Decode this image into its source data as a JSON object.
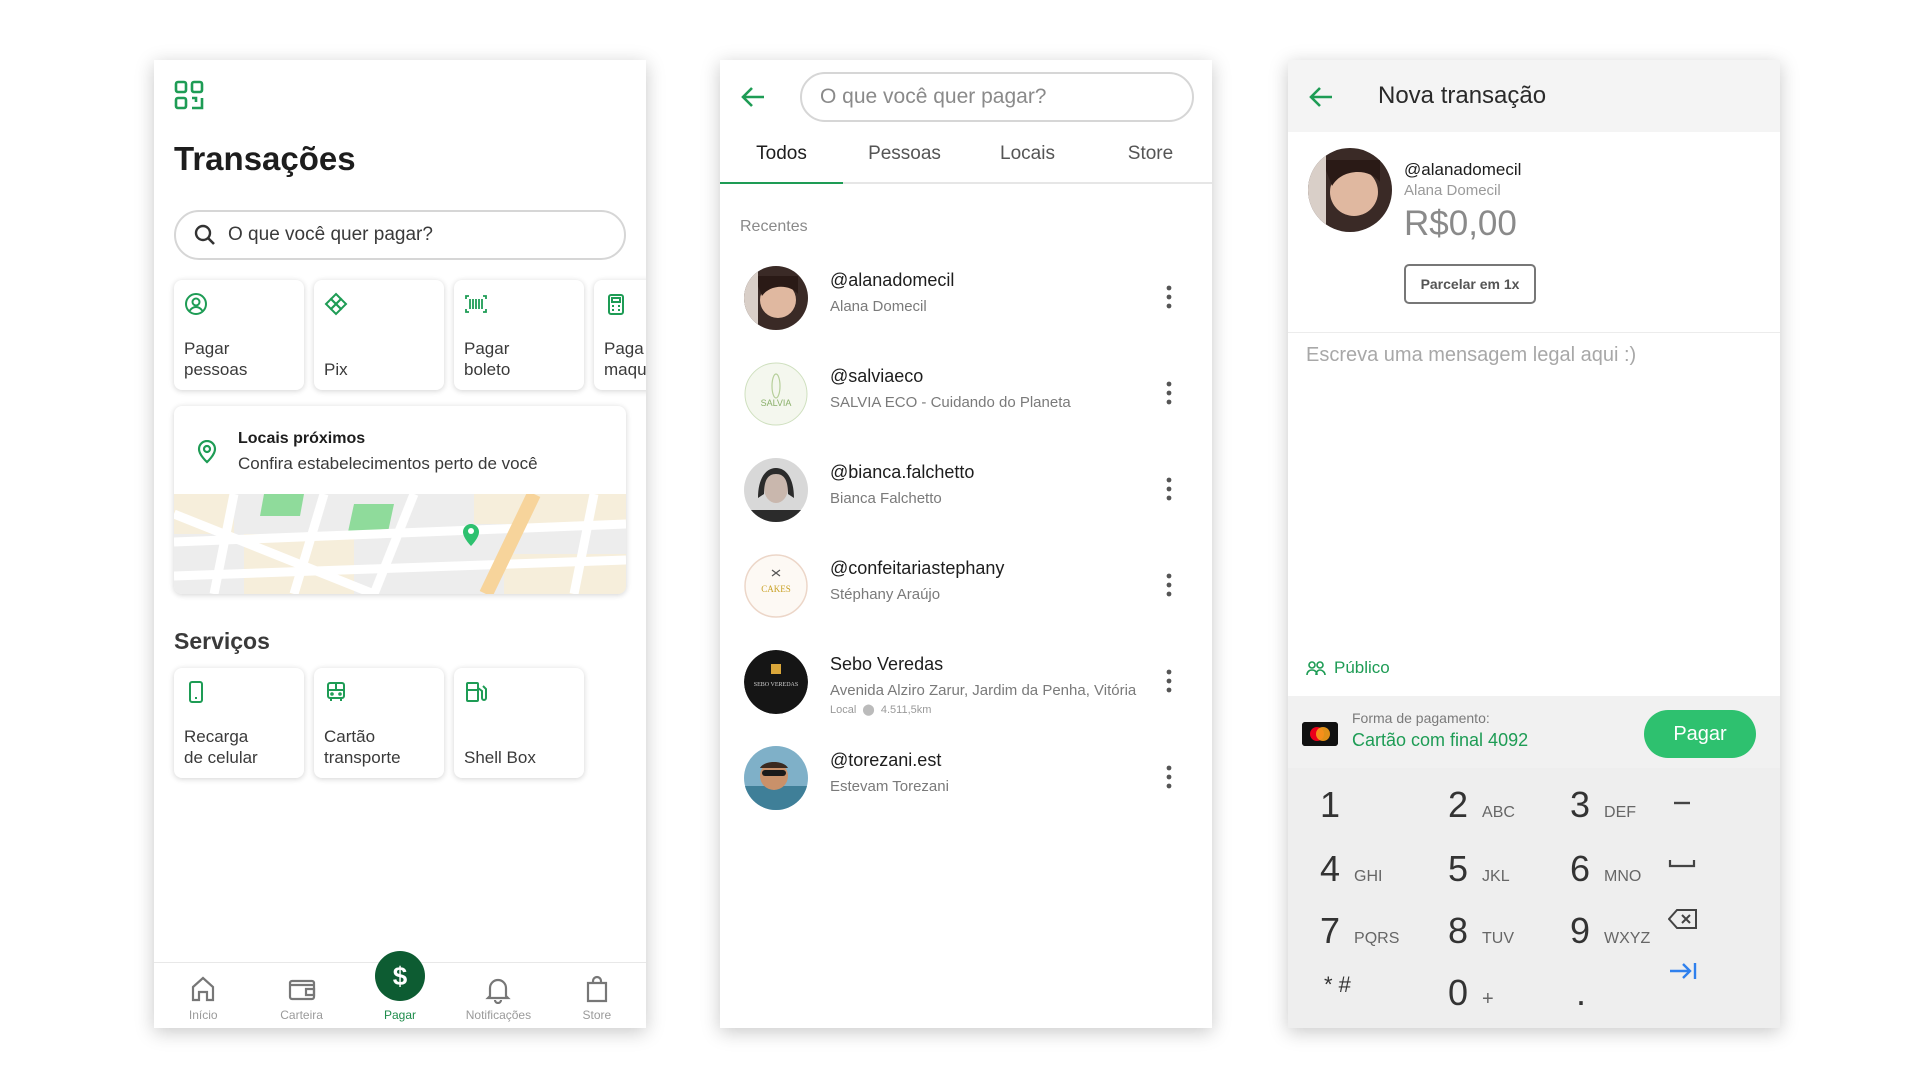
{
  "screen1": {
    "title": "Transações",
    "search_placeholder": "O que você quer pagar?",
    "quick_actions": [
      {
        "label": "Pagar\npessoas",
        "icon": "person-circle-icon"
      },
      {
        "label": "Pix",
        "icon": "pix-icon"
      },
      {
        "label": "Pagar\nboleto",
        "icon": "barcode-icon"
      },
      {
        "label": "Paga\nmaqu",
        "icon": "card-machine-icon"
      }
    ],
    "nearby": {
      "title": "Locais próximos",
      "subtitle": "Confira estabelecimentos perto de você"
    },
    "services_title": "Serviços",
    "services": [
      {
        "label": "Recarga\nde celular",
        "icon": "phone-icon"
      },
      {
        "label": "Cartão\ntransporte",
        "icon": "bus-icon"
      },
      {
        "label": "Shell Box",
        "icon": "fuel-icon"
      }
    ],
    "tabbar": [
      {
        "label": "Início",
        "icon": "home-icon"
      },
      {
        "label": "Carteira",
        "icon": "wallet-icon"
      },
      {
        "label": "Pagar",
        "icon": "dollar-icon",
        "active": true
      },
      {
        "label": "Notificações",
        "icon": "bell-icon"
      },
      {
        "label": "Store",
        "icon": "bag-icon"
      }
    ]
  },
  "screen2": {
    "search_placeholder": "O que você quer pagar?",
    "tabs": [
      "Todos",
      "Pessoas",
      "Locais",
      "Store"
    ],
    "active_tab": "Todos",
    "recent_label": "Recentes",
    "contacts": [
      {
        "handle": "@alanadomecil",
        "sub": "Alana Domecil"
      },
      {
        "handle": "@salviaeco",
        "sub": "SALVIA ECO - Cuidando do Planeta",
        "logo_text": "SALVIA"
      },
      {
        "handle": "@bianca.falchetto",
        "sub": "Bianca Falchetto"
      },
      {
        "handle": "@confeitariastephany",
        "sub": "Stéphany  Araújo",
        "logo_text": "CAKES"
      },
      {
        "handle": "Sebo Veredas",
        "sub": "Avenida Alziro Zarur, Jardim da Penha, Vitória",
        "meta_type": "Local",
        "meta_distance": "4.511,5km",
        "logo_text": "SEBO VEREDAS"
      },
      {
        "handle": "@torezani.est",
        "sub": "Estevam Torezani"
      }
    ]
  },
  "screen3": {
    "title": "Nova transação",
    "handle": "@alanadomecil",
    "name": "Alana Domecil",
    "amount": "R$0,00",
    "installments_button": "Parcelar em 1x",
    "message_placeholder": "Escreva uma mensagem legal aqui :)",
    "privacy": "Público",
    "payment_label": "Forma de pagamento:",
    "payment_card": "Cartão com final 4092",
    "pay_button": "Pagar",
    "keys": [
      {
        "d": "1",
        "l": ""
      },
      {
        "d": "2",
        "l": "ABC"
      },
      {
        "d": "3",
        "l": "DEF"
      },
      {
        "d": "4",
        "l": "GHI"
      },
      {
        "d": "5",
        "l": "JKL"
      },
      {
        "d": "6",
        "l": "MNO"
      },
      {
        "d": "7",
        "l": "PQRS"
      },
      {
        "d": "8",
        "l": "TUV"
      },
      {
        "d": "9",
        "l": "WXYZ"
      },
      {
        "d": "* #",
        "l": ""
      },
      {
        "d": "0",
        "l": "+"
      },
      {
        "d": ".",
        "l": ""
      }
    ],
    "side_keys": [
      "minus-key-icon",
      "space-key-icon",
      "backspace-icon",
      "next-field-icon"
    ]
  },
  "colors": {
    "brand_green": "#1e9c55",
    "pay_button": "#2ec16f",
    "fab": "#0d5c32"
  }
}
